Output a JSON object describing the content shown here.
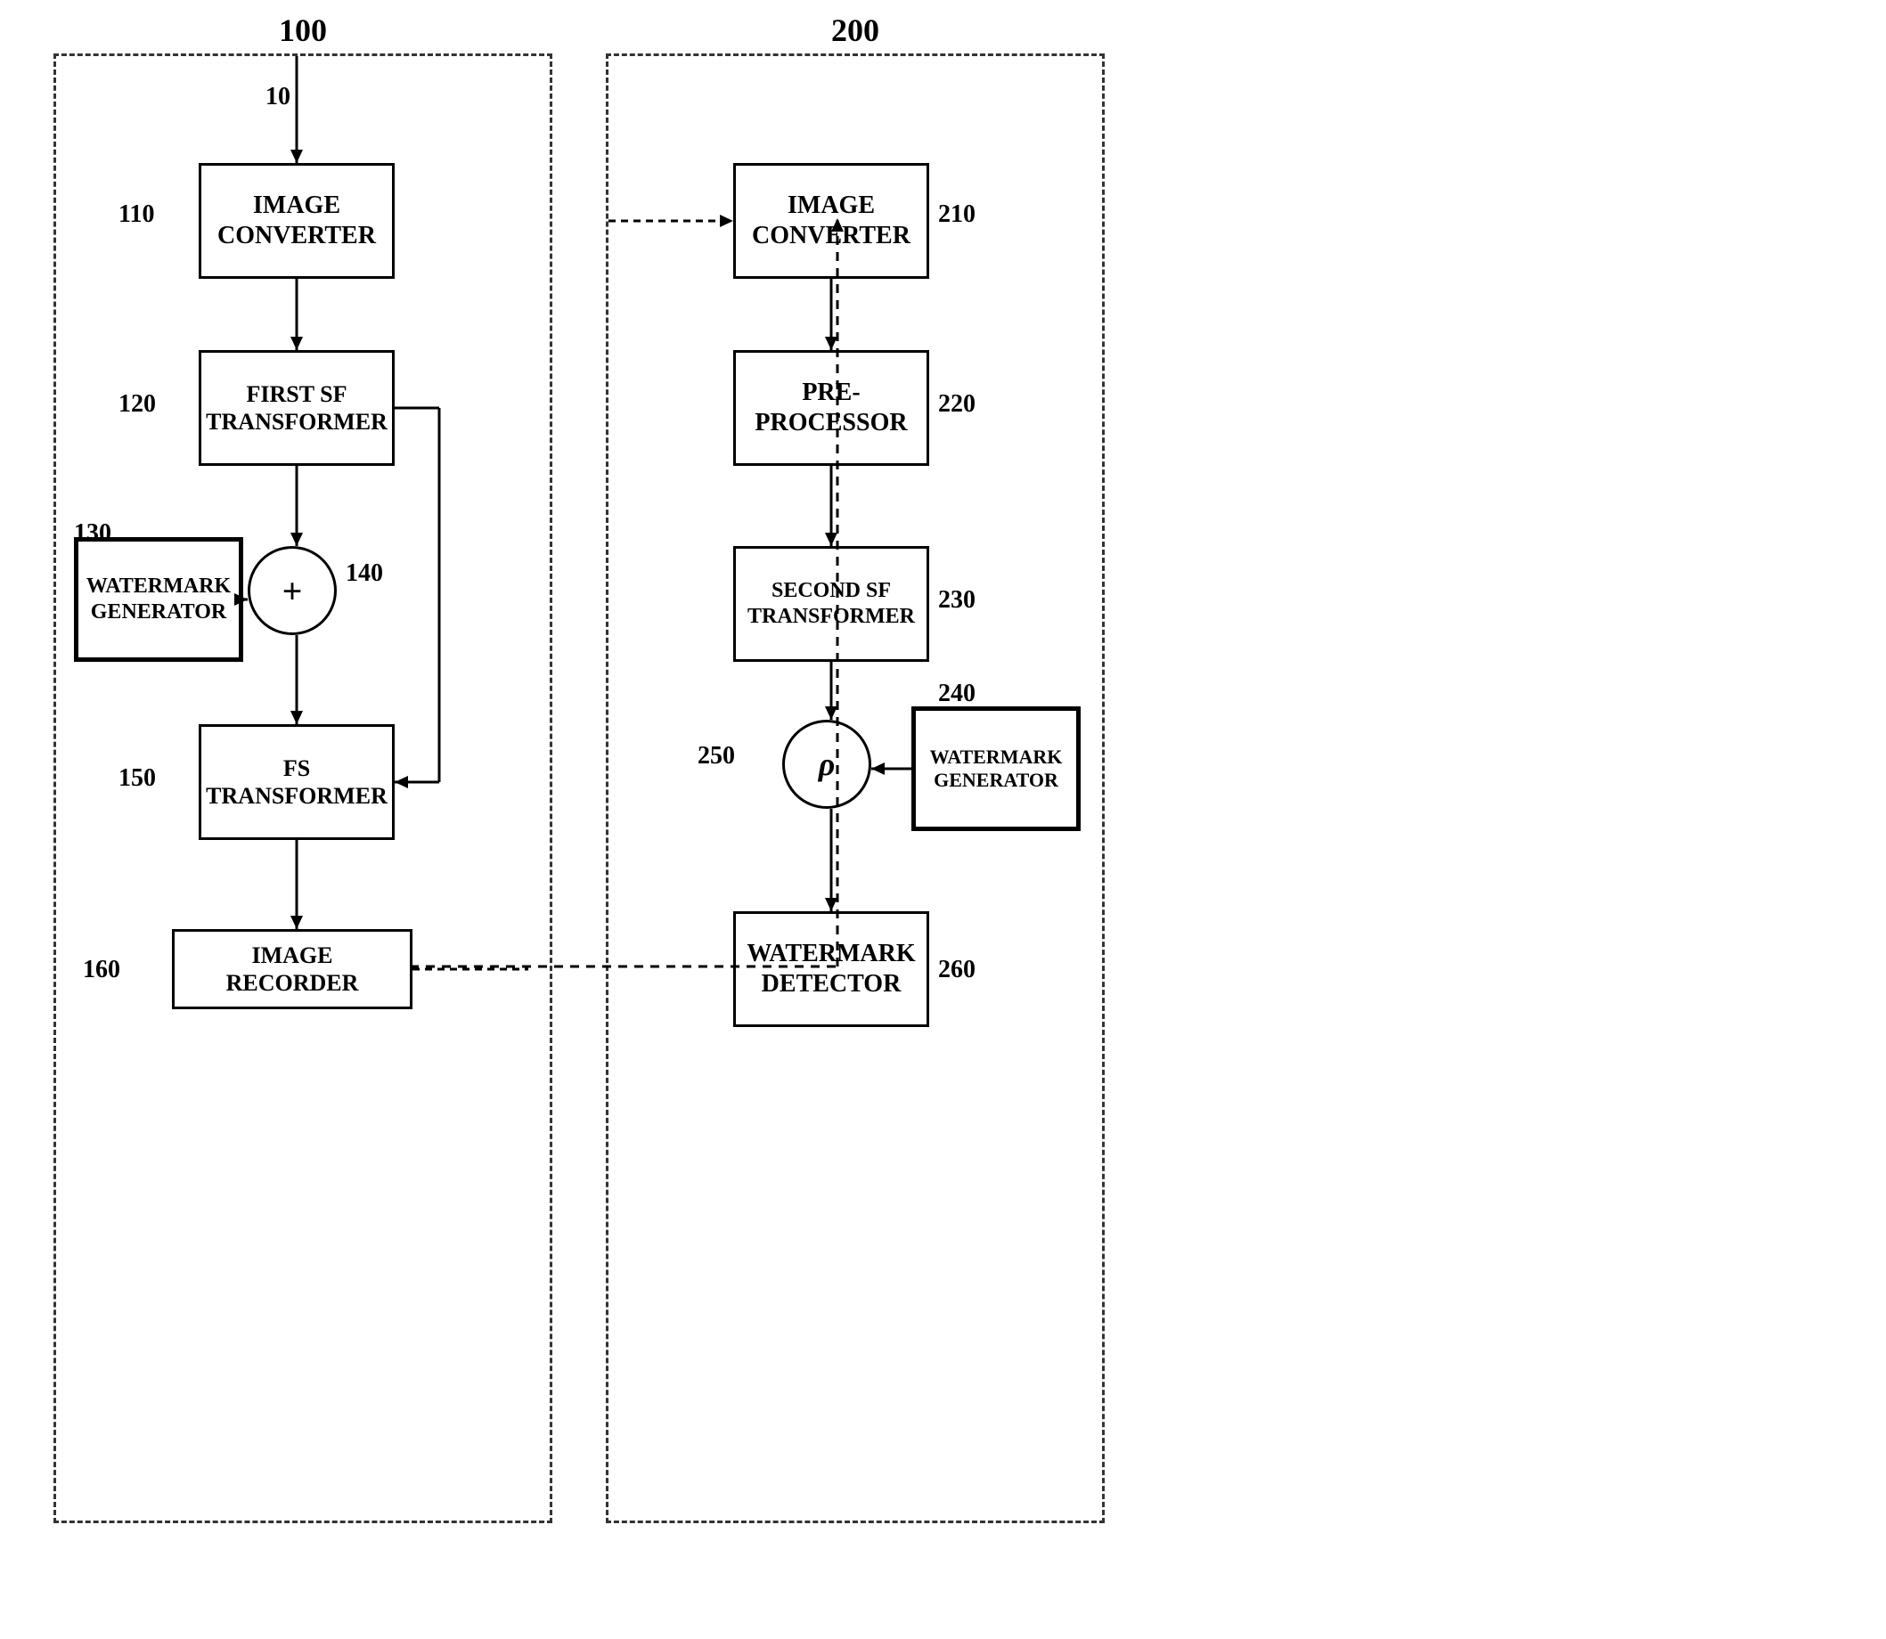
{
  "diagram": {
    "block100": {
      "label": "100",
      "components": {
        "label10": "10",
        "box110": {
          "label": "IMAGE\nCONVERTER",
          "ref": "110"
        },
        "box120": {
          "label": "FIRST SF\nTRANSFORMER",
          "ref": "120"
        },
        "box130": {
          "label": "WATERMARK\nGENERATOR",
          "ref": "130"
        },
        "circle140": {
          "label": "+",
          "ref": "140"
        },
        "box150": {
          "label": "FS\nTRANSFORMER",
          "ref": "150"
        },
        "box160": {
          "label": "IMAGE RECORDER",
          "ref": "160"
        }
      }
    },
    "block200": {
      "label": "200",
      "components": {
        "box210": {
          "label": "IMAGE\nCONVERTER",
          "ref": "210"
        },
        "box220": {
          "label": "PRE-\nPROCESSOR",
          "ref": "220"
        },
        "box230": {
          "label": "SECOND SF\nTRANSFORMER",
          "ref": "230"
        },
        "box240": {
          "label": "WATERMARK\nGENERATOR",
          "ref": "240"
        },
        "circle250": {
          "label": "ρ",
          "ref": "250"
        },
        "box260": {
          "label": "WATERMARK\nDETECTOR",
          "ref": "260"
        }
      }
    }
  }
}
